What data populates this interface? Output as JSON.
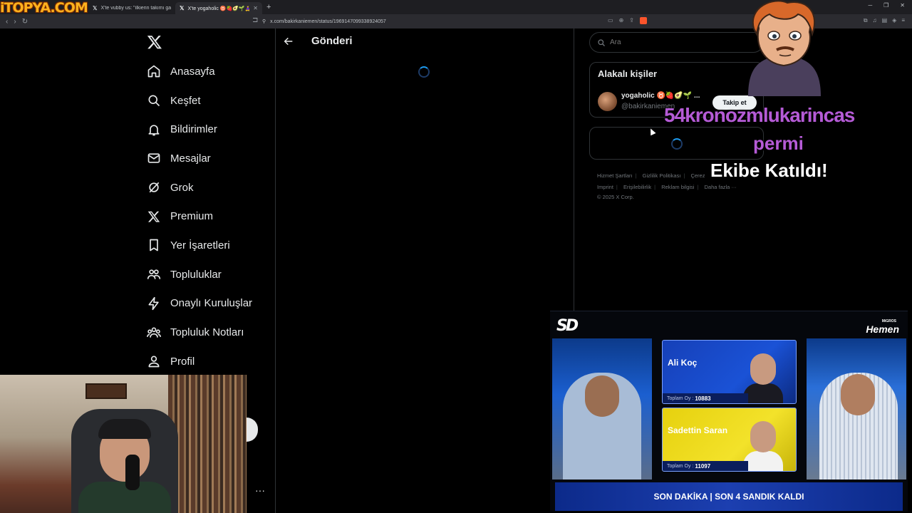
{
  "watermark": {
    "logo_text": "iTOPYA.COM"
  },
  "browser": {
    "tabs": [
      {
        "title": "X'te vubby us: \"ilkierin takımı galatas",
        "active": false
      },
      {
        "title": "X'te yogaholic ♉🍓🥑🌱🧘‍♀️ on",
        "active": true
      }
    ],
    "url": "x.com/bakirkaniemen/status/1969147099338924057"
  },
  "nav": {
    "items": [
      {
        "label": "Anasayfa",
        "icon": "home-icon"
      },
      {
        "label": "Keşfet",
        "icon": "search-icon"
      },
      {
        "label": "Bildirimler",
        "icon": "bell-icon"
      },
      {
        "label": "Mesajlar",
        "icon": "mail-icon"
      },
      {
        "label": "Grok",
        "icon": "grok-icon"
      },
      {
        "label": "Premium",
        "icon": "x-premium-icon"
      },
      {
        "label": "Yer İşaretleri",
        "icon": "bookmark-icon"
      },
      {
        "label": "Topluluklar",
        "icon": "communities-icon"
      },
      {
        "label": "Onaylı Kuruluşlar",
        "icon": "lightning-icon"
      },
      {
        "label": "Topluluk Notları",
        "icon": "community-notes-icon"
      },
      {
        "label": "Profil",
        "icon": "profile-icon"
      }
    ]
  },
  "main": {
    "title": "Gönderi"
  },
  "sidebar": {
    "search_placeholder": "Ara",
    "related_title": "Alakalı kişiler",
    "person": {
      "name": "yogaholic ♉🍓🥑🌱 ...",
      "handle": "@bakirkaniemen",
      "follow_label": "Takip et"
    },
    "footer": {
      "links": [
        "Hizmet Şartları",
        "Gizlilik Politikası",
        "Çerez",
        "Imprint",
        "Erişilebilirlik",
        "Reklam bilgisi",
        "Daha fazla ···"
      ],
      "copyright": "© 2025 X Corp."
    }
  },
  "overlay": {
    "line1": "54kronozmlukarincas",
    "line2": "permi",
    "line3": "Ekibe Katıldı!"
  },
  "tv": {
    "channel": "SD",
    "sponsor_top": "MiGROS",
    "sponsor": "Hemen",
    "vote_prefix": "Toplam Oy :",
    "candidates": [
      {
        "name": "Ali Koç",
        "votes": "10883"
      },
      {
        "name": "Sadettin Saran",
        "votes": "11097"
      }
    ],
    "ticker": "SON DAKİKA | SON 4 SANDIK KALDI"
  },
  "colors": {
    "accent": "#1d9bf0",
    "overlay_purple": "#b55bd6",
    "card_blue": "#1a52d6",
    "card_yellow": "#f3e22a"
  }
}
